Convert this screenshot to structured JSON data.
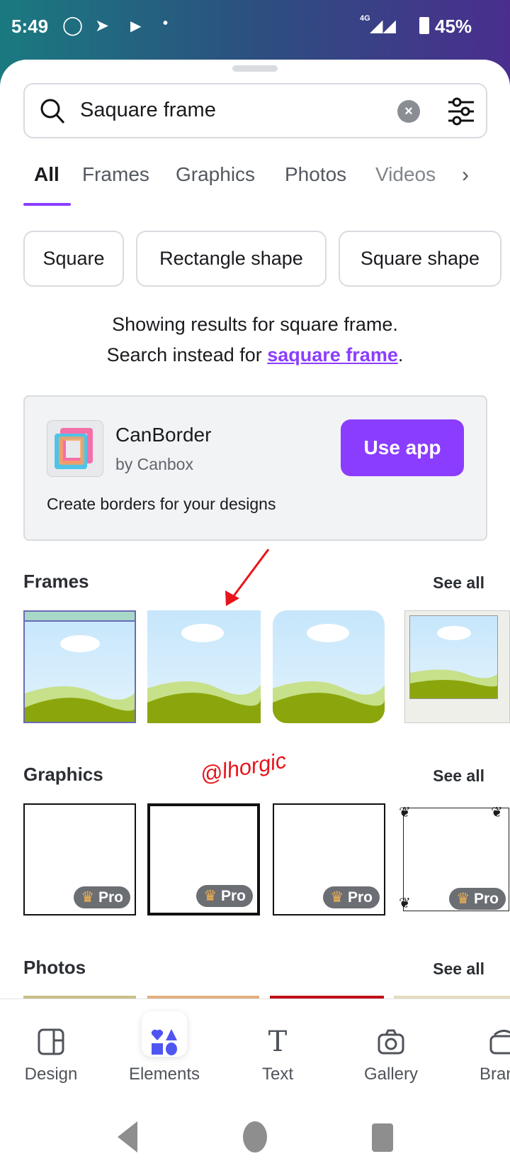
{
  "status": {
    "time": "5:49",
    "network": "4G",
    "battery": "45%",
    "icons": [
      "whatsapp-icon",
      "telegram-icon",
      "play-icon",
      "dot-icon"
    ]
  },
  "search": {
    "value": "Saquare frame"
  },
  "tabs": [
    "All",
    "Frames",
    "Graphics",
    "Photos",
    "Videos"
  ],
  "chips": [
    "Square",
    "Rectangle shape",
    "Square shape"
  ],
  "note": {
    "line1": "Showing results for square frame.",
    "line2_prefix": "Search instead for ",
    "link": "saquare frame",
    "line2_suffix": "."
  },
  "app": {
    "name": "CanBorder",
    "by": "by Canbox",
    "description": "Create borders for your designs",
    "button": "Use app"
  },
  "sections": {
    "frames": "Frames",
    "graphics": "Graphics",
    "photos": "Photos",
    "see_all": "See all"
  },
  "pro_label": "Pro",
  "watermark": "@lhorgic",
  "nav": [
    "Design",
    "Elements",
    "Text",
    "Gallery",
    "Brand"
  ],
  "colors": {
    "accent": "#8b3dff",
    "elements_icon": "#4f55f1"
  }
}
